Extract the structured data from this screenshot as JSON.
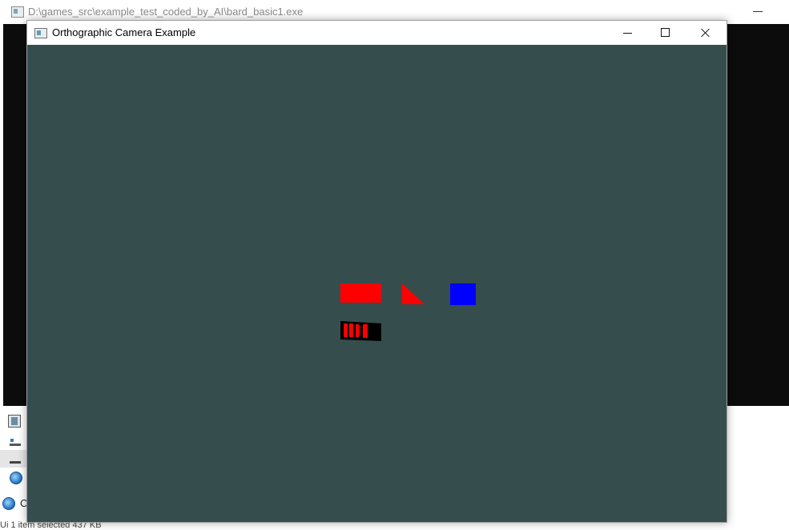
{
  "background_window": {
    "title": "D:\\games_src\\example_test_coded_by_AI\\bard_basic1.exe",
    "console_color": "#0c0c0c"
  },
  "sidebar": {
    "letter": "C",
    "status": "Ui         1 item selected  437 KB"
  },
  "game_window": {
    "title": "Orthographic Camera Example",
    "buttons": {
      "minimize": "minimize",
      "maximize": "maximize",
      "close": "close"
    },
    "clear_color": "#354d4d",
    "shapes": [
      {
        "name": "red-rectangle",
        "kind": "rect",
        "color": "#ff0000"
      },
      {
        "name": "red-triangle",
        "kind": "triangle",
        "color": "#ff0000"
      },
      {
        "name": "blue-square",
        "kind": "rect",
        "color": "#0000ff"
      },
      {
        "name": "textured-quad",
        "kind": "textured",
        "color": "#ff0000",
        "bg": "#000000"
      }
    ]
  },
  "icons": {
    "window_icon": "window-app-icon",
    "minimize": "minimize-icon",
    "maximize": "maximize-icon",
    "close": "close-icon"
  }
}
